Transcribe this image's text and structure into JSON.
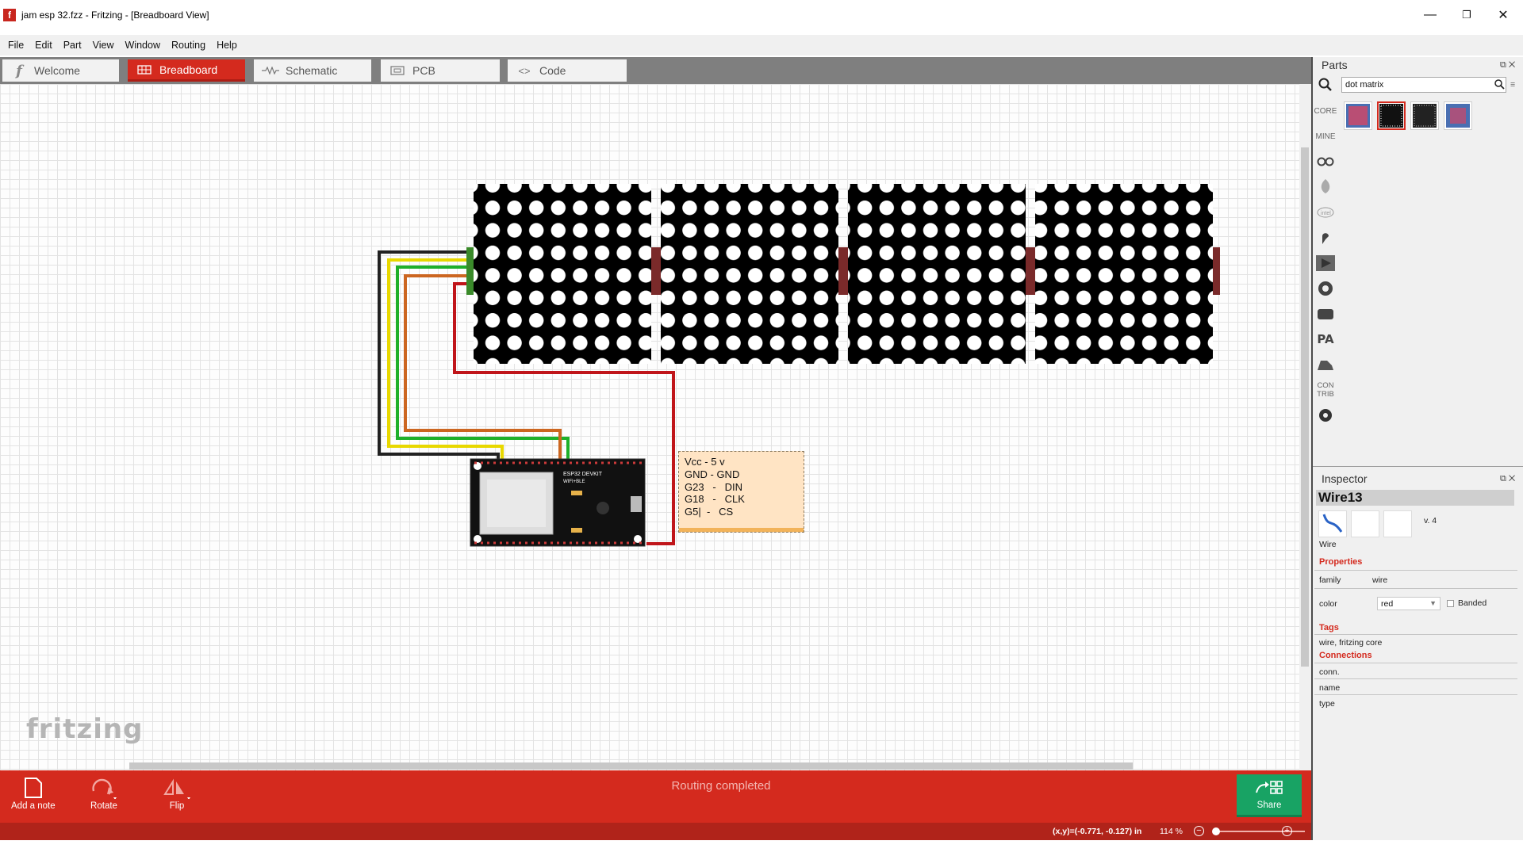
{
  "window": {
    "title": "jam esp 32.fzz - Fritzing - [Breadboard View]",
    "minimize": "—",
    "maximize": "❐",
    "close": "✕"
  },
  "menu": [
    "File",
    "Edit",
    "Part",
    "View",
    "Window",
    "Routing",
    "Help"
  ],
  "tabs": [
    {
      "label": "Welcome",
      "icon": "fritzing-f-icon",
      "active": false
    },
    {
      "label": "Breadboard",
      "icon": "breadboard-icon",
      "active": true
    },
    {
      "label": "Schematic",
      "icon": "resistor-icon",
      "active": false
    },
    {
      "label": "PCB",
      "icon": "pcb-icon",
      "active": false
    },
    {
      "label": "Code",
      "icon": "code-icon",
      "active": false
    }
  ],
  "canvas": {
    "watermark": "fritzing",
    "note_text": "Vcc - 5 v\nGND - GND\nG23   -   DIN\nG18   -   CLK\nG5|  -   CS",
    "esp32_label_line1": "ESP32 DEVKIT",
    "esp32_label_line2": "WIFI+BLE",
    "wire_colors": {
      "black": "#222222",
      "yellow": "#e8d800",
      "green": "#1fb02a",
      "orange": "#cc6620",
      "red": "#c0151a"
    }
  },
  "parts_panel": {
    "title": "Parts",
    "search_value": "dot matrix",
    "bins": [
      "CORE",
      "MINE",
      "arduino-icon",
      "seeed-icon",
      "intel-icon",
      "sparkfun-icon",
      "snootlab-icon",
      "adafruit-icon",
      "lilypad-icon",
      "PA",
      "dfrobot-icon",
      "CON TRIB",
      "gear-icon"
    ],
    "results": [
      "dot-matrix-red-icon",
      "dot-matrix-white-icon",
      "dot-matrix-black-icon",
      "dot-matrix-mixed-icon"
    ]
  },
  "inspector": {
    "title": "Inspector",
    "part_name": "Wire13",
    "part_caption": "Wire",
    "version": "v. 4",
    "properties_header": "Properties",
    "family_label": "family",
    "family_value": "wire",
    "color_label": "color",
    "color_value": "red",
    "banded_label": "Banded",
    "tags_header": "Tags",
    "tags_value": "wire, fritzing core",
    "connections_header": "Connections",
    "conn_label": "conn.",
    "name_label": "name",
    "type_label": "type"
  },
  "toolbar": {
    "add_note": "Add a note",
    "rotate": "Rotate",
    "flip": "Flip",
    "status": "Routing completed",
    "share": "Share"
  },
  "statusbar": {
    "coords": "(x,y)=(-0.771, -0.127) in",
    "zoom": "114 %"
  },
  "colors": {
    "accent": "#d42a1e",
    "share": "#18a364",
    "note": "#ffe4c4"
  }
}
